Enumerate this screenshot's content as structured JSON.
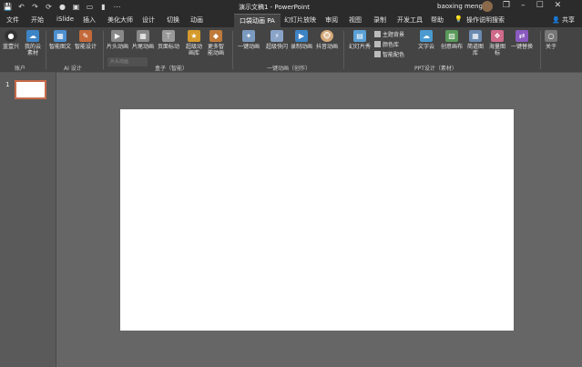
{
  "titlebar": {
    "doc_title": "演示文稿1 - PowerPoint",
    "user_name": "baoxing meng",
    "icons": [
      "save-icon",
      "undo-icon",
      "redo-icon",
      "repeat-icon",
      "record-icon",
      "present-icon",
      "monitor-icon",
      "bookmark-icon",
      "more-icon"
    ],
    "win": {
      "minimize": "–",
      "restore": "❐",
      "maximize": "☐",
      "close": "✕"
    }
  },
  "tabs": [
    "文件",
    "开始",
    "iSlide",
    "插入",
    "美化大师",
    "设计",
    "切换",
    "动画",
    "口袋动画 PA",
    "幻灯片放映",
    "审阅",
    "视图",
    "录制",
    "开发工具",
    "帮助",
    "操作说明搜索"
  ],
  "share": "共享",
  "ribbon": {
    "account": {
      "login": "蓝壹兴",
      "my_assets": "我的云素材",
      "group": "账户"
    },
    "ai": {
      "smart_text": "智能图文",
      "smart_design": "智能设计",
      "group": "AI 设计"
    },
    "box": {
      "intro": "片头动画",
      "outro": "片尾动画",
      "page_label": "页面标动",
      "effects": "超级动画库",
      "more": "更多智能动画",
      "group": "盒子（智能）"
    },
    "onekey": {
      "one_key_anim": "一键动画",
      "super_quick": "超级快闪",
      "record_anim": "录制动画",
      "shake_anim": "抖音动画",
      "group": "一键动画（创作）"
    },
    "ppt": {
      "slides_show": "幻灯片秀",
      "theme_color": "主题背景",
      "image_lib": "颜色库",
      "smart_color": "智能配色",
      "text_cloud": "文字云",
      "creative": "创意画布",
      "ppt_gallery": "简道图库",
      "sea_icons": "海量图标",
      "one_click_replace": "一键替换",
      "group": "PPT设计（素材）"
    },
    "about": {
      "label": "关于"
    },
    "tooltip": "片头动画"
  },
  "slides": {
    "number": "1"
  }
}
